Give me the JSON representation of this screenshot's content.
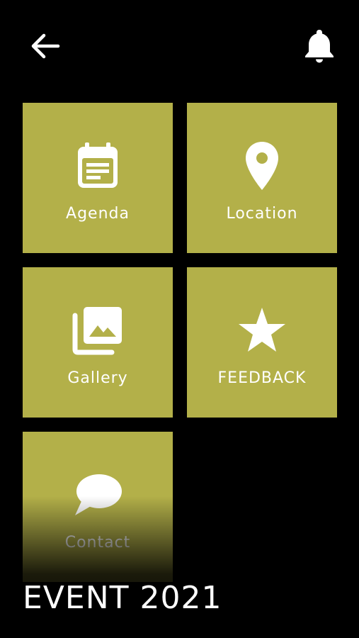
{
  "colors": {
    "background": "#000000",
    "tile": "#B3B049",
    "icon": "#ffffff"
  },
  "header": {
    "back_icon": "arrow-left",
    "notification_icon": "bell"
  },
  "tiles": [
    {
      "label": "Agenda",
      "icon": "calendar-icon"
    },
    {
      "label": "Location",
      "icon": "map-pin-icon"
    },
    {
      "label": "Gallery",
      "icon": "photo-library-icon"
    },
    {
      "label": "FEEDBACK",
      "icon": "star-icon"
    },
    {
      "label": "Contact",
      "icon": "chat-bubble-icon"
    }
  ],
  "footer": {
    "title": "EVENT 2021"
  }
}
